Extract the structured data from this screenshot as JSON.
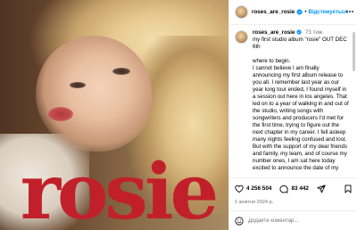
{
  "post": {
    "image": {
      "logo_text": "rosie",
      "logo_color": "#c1202a"
    },
    "header": {
      "username": "roses_are_rosie",
      "follow_label": "Відстежується",
      "verified_color": "#0095f6"
    },
    "caption": {
      "username": "roses_are_rosie",
      "time": "73 тиж.",
      "lines": [
        "my first studio album \"rosie\" OUT DEC 6th",
        "where to begin.",
        "I cannot believe I am finally announcing my first album release to you all. I remember last year as our year long tour ended, I found myself in a session out here in los angeles. That led on to a year of walking in and out of the studio, writing songs with songwriters and producers I'd met for the first time, trying to figure out the next chapter in my career. I fell asleep many nights feeling confused and lost. But with the support of my dear friends and family, my team, and of course my number ones, I am sat here today excited to announce the date of my"
      ]
    },
    "actions": {
      "likes": "4 256 504",
      "comments": "83 442"
    },
    "date": "1 жовтня 2024 р.",
    "comment_box": {
      "placeholder": "Додайте коментар..."
    }
  },
  "colors": {
    "link": "#0095f6",
    "muted": "#737373",
    "divider": "#efefef"
  },
  "icons": [
    "verified-badge-icon",
    "more-options-icon",
    "heart-icon",
    "comment-icon",
    "share-icon",
    "bookmark-icon",
    "emoji-icon"
  ]
}
